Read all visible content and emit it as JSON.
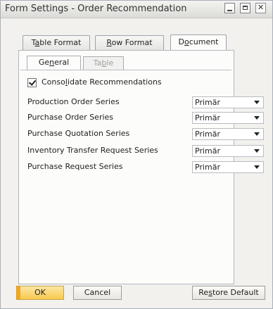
{
  "window": {
    "title": "Form Settings - Order Recommendation"
  },
  "tabs": [
    {
      "label_pre": "T",
      "label_ul": "a",
      "label_post": "ble Format"
    },
    {
      "label_pre": "",
      "label_ul": "R",
      "label_post": "ow Format"
    },
    {
      "label_pre": "D",
      "label_ul": "o",
      "label_post": "cument"
    }
  ],
  "subtabs": [
    {
      "label_pre": "Ge",
      "label_ul": "n",
      "label_post": "eral"
    },
    {
      "label_pre": "Ta",
      "label_ul": "b",
      "label_post": "le"
    }
  ],
  "consolidate": {
    "label_pre": "Conso",
    "label_ul": "l",
    "label_post": "idate Recommendations",
    "checked": true
  },
  "series": [
    {
      "label": "Production Order Series",
      "value": "Primär"
    },
    {
      "label": "Purchase Order Series",
      "value": "Primär"
    },
    {
      "label": "Purchase Quotation Series",
      "value": "Primär"
    },
    {
      "label": "Inventory Transfer Request Series",
      "value": "Primär"
    },
    {
      "label": "Purchase Request Series",
      "value": "Primär"
    }
  ],
  "buttons": {
    "ok": "OK",
    "cancel": "Cancel",
    "restore_pre": "Re",
    "restore_ul": "s",
    "restore_post": "tore Default"
  }
}
